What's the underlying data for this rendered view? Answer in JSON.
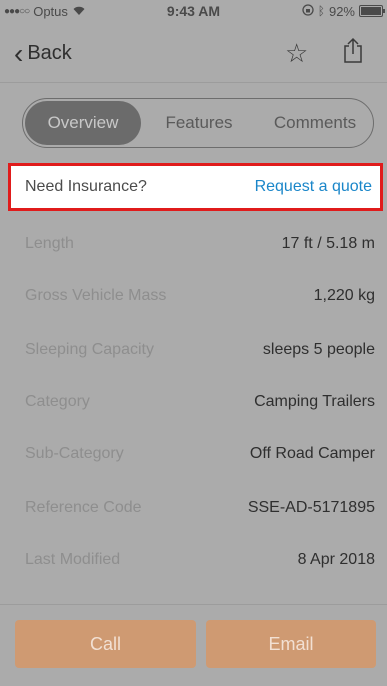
{
  "status_bar": {
    "carrier": "Optus",
    "time": "9:43 AM",
    "battery": "92%"
  },
  "nav": {
    "back_label": "Back"
  },
  "tabs": [
    {
      "label": "Overview",
      "active": true
    },
    {
      "label": "Features",
      "active": false
    },
    {
      "label": "Comments",
      "active": false
    }
  ],
  "insurance": {
    "label": "Need Insurance?",
    "link": "Request a quote"
  },
  "details": [
    {
      "key": "Length",
      "value": "17 ft / 5.18 m"
    },
    {
      "key": "Gross Vehicle Mass",
      "value": "1,220 kg"
    },
    {
      "key": "Sleeping Capacity",
      "value": "sleeps 5 people"
    },
    {
      "key": "Category",
      "value": "Camping Trailers"
    },
    {
      "key": "Sub-Category",
      "value": "Off Road Camper"
    },
    {
      "key": "Reference Code",
      "value": "SSE-AD-5171895"
    },
    {
      "key": "Last Modified",
      "value": "8 Apr 2018"
    }
  ],
  "actions": {
    "call_label": "Call",
    "email_label": "Email"
  },
  "colors": {
    "accent_link": "#1a86c9",
    "highlight_border": "#e01b1b",
    "action_button": "#cf9a72"
  }
}
